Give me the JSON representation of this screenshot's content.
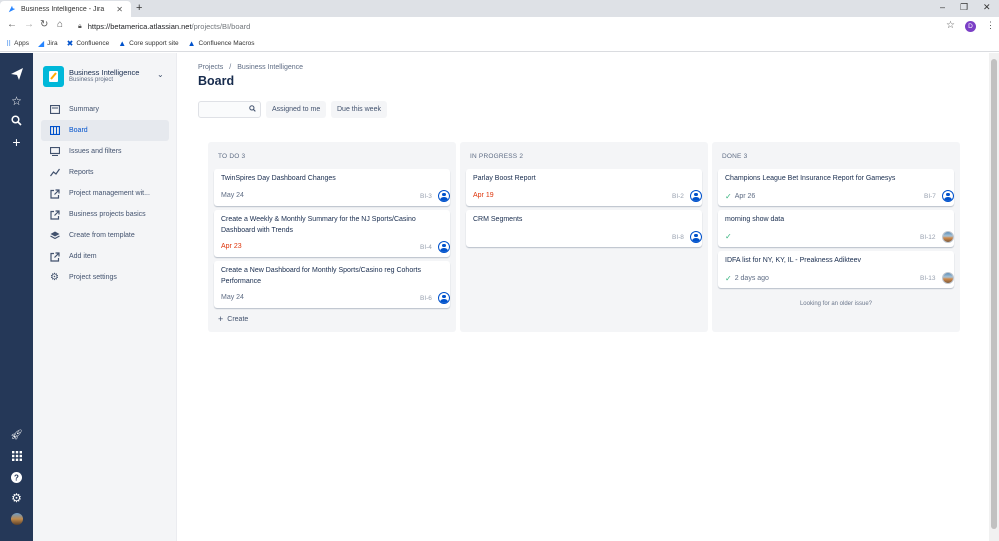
{
  "browser": {
    "tab_title": "Business Intelligence - Jira",
    "url_host": "https://betamerica.atlassian.net",
    "url_path": "/projects/BI/board",
    "profile_initial": "D",
    "bookmarks": [
      {
        "label": "Apps",
        "icon": "apps-grid-icon"
      },
      {
        "label": "Jira",
        "icon": "jira-icon"
      },
      {
        "label": "Confluence",
        "icon": "confluence-icon"
      },
      {
        "label": "Core support site",
        "icon": "atlassian-icon"
      },
      {
        "label": "Confluence Macros",
        "icon": "atlassian-icon"
      }
    ]
  },
  "project": {
    "name": "Business Intelligence",
    "type": "Business project"
  },
  "sidebar": {
    "items": [
      {
        "label": "Summary",
        "icon": "summary-icon"
      },
      {
        "label": "Board",
        "icon": "board-icon",
        "active": true
      },
      {
        "label": "Issues and filters",
        "icon": "issues-icon"
      },
      {
        "label": "Reports",
        "icon": "reports-icon"
      },
      {
        "label": "Project management wit...",
        "icon": "external-link-icon"
      },
      {
        "label": "Business projects basics",
        "icon": "external-link-icon"
      },
      {
        "label": "Create from template",
        "icon": "template-icon"
      },
      {
        "label": "Add item",
        "icon": "add-item-icon"
      },
      {
        "label": "Project settings",
        "icon": "settings-icon"
      }
    ]
  },
  "main": {
    "breadcrumb": [
      "Projects",
      "Business Intelligence"
    ],
    "title": "Board",
    "search_value": "",
    "filters": [
      "Assigned to me",
      "Due this week"
    ]
  },
  "board": {
    "columns": [
      {
        "header": "TO DO 3",
        "cards": [
          {
            "title": "TwinSpires Day Dashboard Changes",
            "date": "May 24",
            "key": "BI-3",
            "overdue": false
          },
          {
            "title": "Create a Weekly & Monthly Summary for the NJ Sports/Casino Dashboard with Trends",
            "date": "Apr 23",
            "key": "BI-4",
            "overdue": true
          },
          {
            "title": "Create a New Dashboard for Monthly Sports/Casino reg Cohorts Performance",
            "date": "May 24",
            "key": "BI-6",
            "overdue": false
          }
        ],
        "create_label": "Create"
      },
      {
        "header": "IN PROGRESS 2",
        "cards": [
          {
            "title": "Parlay Boost Report",
            "date": "Apr 19",
            "key": "BI-2",
            "overdue": true
          },
          {
            "title": "CRM Segments",
            "date": "",
            "key": "BI-8",
            "overdue": false
          }
        ]
      },
      {
        "header": "DONE 3",
        "cards": [
          {
            "title": "Champions League Bet Insurance Report for Gamesys",
            "date": "Apr 26",
            "key": "BI-7",
            "done": true
          },
          {
            "title": "morning show data",
            "date": "",
            "key": "BI-12",
            "done": true
          },
          {
            "title": "IDFA list for NY, KY, IL - Preakness Adikteev",
            "date": "2 days ago",
            "key": "BI-13",
            "done": true
          }
        ],
        "older_link": "Looking for an older issue?"
      }
    ]
  },
  "colors": {
    "global_nav": "#253858",
    "accent": "#0052cc",
    "overdue": "#de350b",
    "done_check": "#36b37e"
  }
}
